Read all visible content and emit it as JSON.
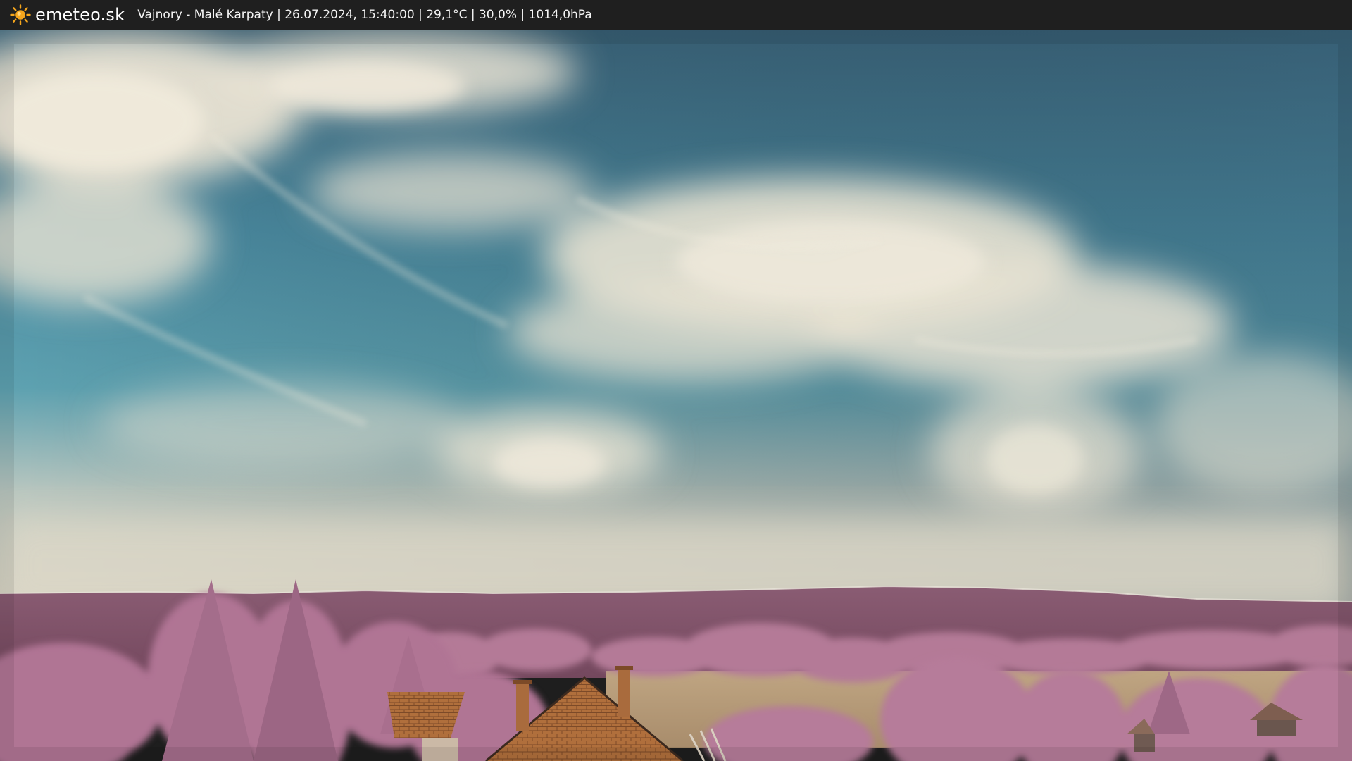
{
  "header": {
    "brand": "emeteo.sk",
    "logo_icon": "sun-icon",
    "caption": "Vajnory - Malé Karpaty | 26.07.2024, 15:40:00 | 29,1°C | 30,0% | 1014,0hPa"
  },
  "colors": {
    "bar_background": "#1f1f1f",
    "sun": "#f4a51c",
    "sky_top": "#3f6c86",
    "sky_mid": "#4f93a8",
    "cloud": "#e6e1d2",
    "hills": "#8a5d74",
    "trees": "#b57b99",
    "roof": "#b9763f",
    "field": "#b39a78"
  }
}
